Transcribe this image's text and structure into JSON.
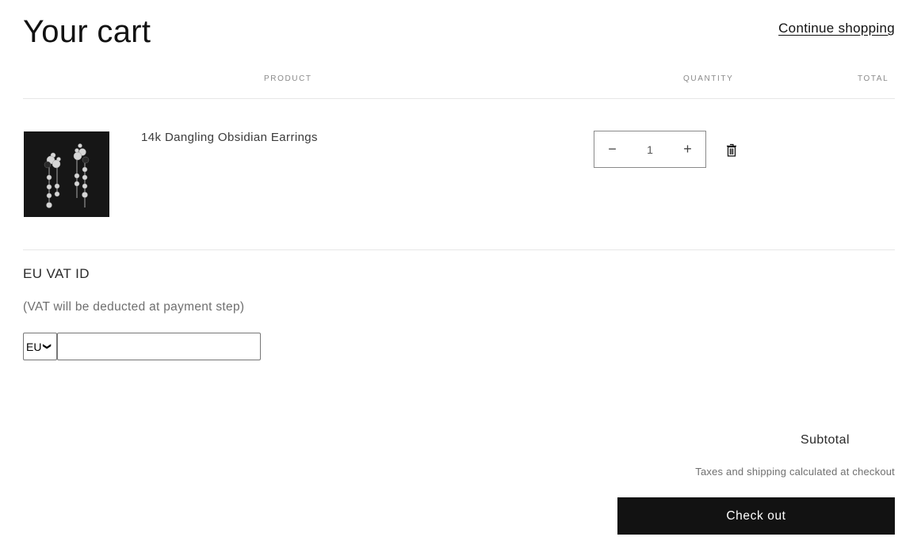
{
  "header": {
    "title": "Your cart",
    "continue_shopping": "Continue shopping"
  },
  "table": {
    "columns": [
      "Product",
      "Quantity",
      "Total"
    ]
  },
  "items": [
    {
      "name": "14k Dangling Obsidian Earrings",
      "quantity": "1",
      "image_icon": "earrings-product-image",
      "decrease_label": "−",
      "increase_label": "+",
      "remove_icon": "trash-icon"
    }
  ],
  "vat": {
    "title": "EU VAT ID",
    "note": "(VAT will be deducted at payment step)",
    "country_selected": "EU",
    "input_value": "",
    "input_placeholder": ""
  },
  "summary": {
    "subtotal_label": "Subtotal",
    "tax_note": "Taxes and shipping calculated at checkout",
    "checkout_label": "Check out"
  },
  "colors": {
    "text": "#121212",
    "muted": "#6f6f6f",
    "button_bg": "#121212",
    "button_text": "#ffffff",
    "divider": "#e6e6e6"
  }
}
